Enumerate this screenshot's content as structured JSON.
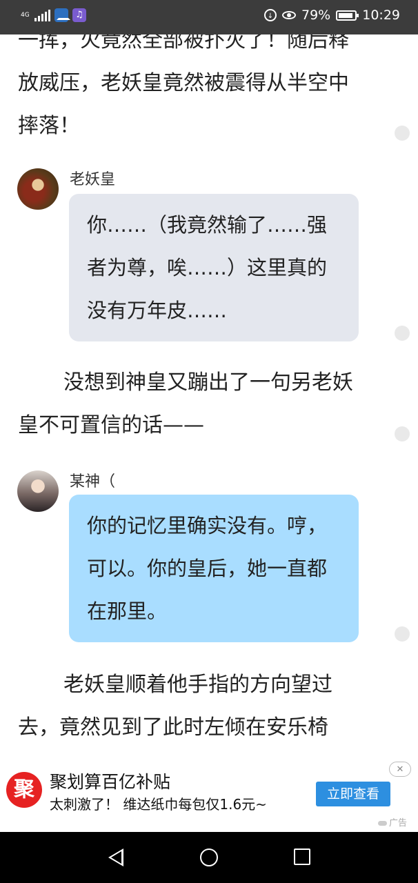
{
  "status_bar": {
    "network": "4G",
    "battery_percent": "79%",
    "time": "10:29",
    "icons": [
      "signal-icon",
      "app-icon",
      "music-icon",
      "data-saver-icon",
      "eye-comfort-icon",
      "battery-icon"
    ]
  },
  "story": {
    "para_top": "一挥，火竟然全部被扑灭了！随后释放威压，老妖皇竟然被震得从半空中摔落！",
    "dialogue_1": {
      "speaker": "老妖皇",
      "text": "你……（我竟然输了……强者为尊，唉……）这里真的没有万年皮……"
    },
    "para_mid": "没想到神皇又蹦出了一句另老妖皇不可置信的话——",
    "dialogue_2": {
      "speaker": "某神（",
      "text": "你的记忆里确实没有。哼，可以。你的皇后，她一直都在那里。"
    },
    "para_bottom": "老妖皇顺着他手指的方向望过去，竟然见到了此时左倾在安乐椅"
  },
  "ad": {
    "logo": "聚",
    "title": "聚划算百亿补贴",
    "description": "太刺激了！ 维达纸巾每包仅1.6元~",
    "button": "立即查看",
    "close": "✕",
    "label": "广告"
  },
  "colors": {
    "status_bg": "#3c3c3c",
    "bubble_grey": "#e4e7ee",
    "bubble_blue": "#a9ddff",
    "ad_button": "#2d8fe0",
    "ad_logo": "#e62222"
  }
}
